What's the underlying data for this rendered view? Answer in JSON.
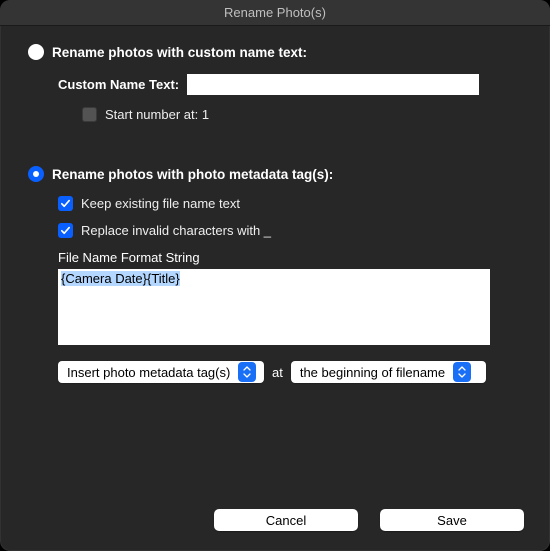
{
  "window": {
    "title": "Rename Photo(s)"
  },
  "option_custom": {
    "label": "Rename photos with custom name text:",
    "custom_name_label": "Custom Name Text:",
    "custom_name_value": "",
    "start_number_label": "Start number at: 1"
  },
  "option_metadata": {
    "label": "Rename photos with photo metadata tag(s):",
    "keep_existing_label": "Keep existing file name text",
    "replace_invalid_label": "Replace invalid characters with _",
    "format_label": "File Name Format String",
    "format_value": "{Camera Date}{Title}",
    "insert_select": "Insert photo metadata tag(s)",
    "at_label": "at",
    "position_select": "the beginning of filename"
  },
  "footer": {
    "cancel": "Cancel",
    "save": "Save"
  }
}
